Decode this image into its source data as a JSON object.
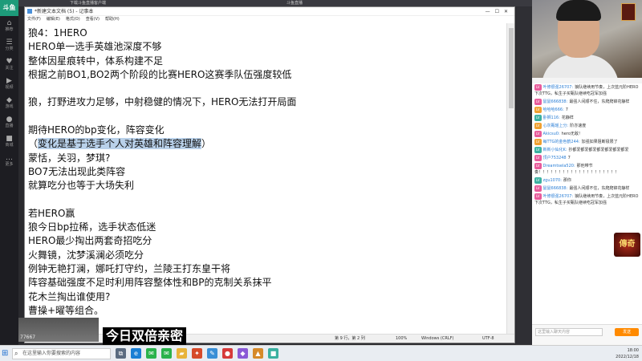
{
  "sidebar": {
    "logo": "斗鱼",
    "items": [
      {
        "icon": "home-icon",
        "glyph": "⌂",
        "label": "推荐"
      },
      {
        "icon": "category-icon",
        "glyph": "☰",
        "label": "分类"
      },
      {
        "icon": "follow-icon",
        "glyph": "♥",
        "label": "关注"
      },
      {
        "icon": "video-icon",
        "glyph": "▶",
        "label": "视频"
      },
      {
        "icon": "game-icon",
        "glyph": "◆",
        "label": "游戏"
      },
      {
        "icon": "live-icon",
        "glyph": "●",
        "label": "直播"
      },
      {
        "icon": "shop-icon",
        "glyph": "■",
        "label": "商城"
      },
      {
        "icon": "more-icon",
        "glyph": "…",
        "label": "更多"
      }
    ]
  },
  "browser_tabs": [
    "下载斗鱼直播客户端",
    "斗鱼直播"
  ],
  "notepad": {
    "title": "*新建文本文档 (5) - 记事本",
    "window_controls": "—☐✕",
    "menu": [
      "文件(F)",
      "编辑(E)",
      "格式(O)",
      "查看(V)",
      "帮助(H)"
    ],
    "lines": [
      {
        "text": "狼4：1HERO"
      },
      {
        "text": "HERO单一选手英雄池深度不够"
      },
      {
        "text": "整体因星痕转中，体系构建不足"
      },
      {
        "text": "根据之前BO1,BO2两个阶段的比赛HERO这赛季队伍强度较低"
      },
      {
        "text": ""
      },
      {
        "text": "狼，打野进攻力足够，中射稳健的情况下，HERO无法打开局面"
      },
      {
        "text": ""
      },
      {
        "text": "期待HERO的bp变化，阵容变化"
      },
      {
        "pre": "（",
        "sel": "变化是基于选手个人对英雄和阵容理解",
        "post": "）"
      },
      {
        "text": "蒙恬，关羽，梦琪?"
      },
      {
        "text": "BO7无法出现此类阵容"
      },
      {
        "text": "就算吃分也等于大场失利"
      },
      {
        "text": ""
      },
      {
        "text": "若HERO赢"
      },
      {
        "text": "狼今日bp拉稀，选手状态低迷"
      },
      {
        "text": "HERO最少掏出两套奇招吃分"
      },
      {
        "text": "火舞镜，沈梦溪澜必须吃分"
      },
      {
        "text": "例钟无艳打澜，娜吒打守约，兰陵王打东皇干将"
      },
      {
        "text": "阵容基础强度不足时利用阵容整体性和BP的克制关系抹平"
      },
      {
        "text": "花木兰掏出谁使用?"
      },
      {
        "text": "曹操+曜等组合。"
      }
    ],
    "status": {
      "position": "第 9 行，第 2 列",
      "zoom": "100%",
      "line_ending": "Windows (CRLF)",
      "encoding": "UTF-8"
    }
  },
  "caption": "今日双倍亲密",
  "viewer_count": "77667",
  "taskbar": {
    "search_placeholder": "在这里输入你要搜索的内容",
    "apps": [
      {
        "name": "task-view-icon",
        "glyph": "⧉",
        "color": "#5a6b80"
      },
      {
        "name": "edge-icon",
        "glyph": "e",
        "color": "#1a7fd4"
      },
      {
        "name": "wechat-icon",
        "glyph": "✉",
        "color": "#2bb24c"
      },
      {
        "name": "wechat2-icon",
        "glyph": "✉",
        "color": "#2bb24c"
      },
      {
        "name": "folder-icon",
        "glyph": "▰",
        "color": "#e8b33a"
      },
      {
        "name": "game-icon",
        "glyph": "✦",
        "color": "#d64a2a"
      },
      {
        "name": "notepad-icon",
        "glyph": "✎",
        "color": "#3a8fd6"
      },
      {
        "name": "app-icon",
        "glyph": "●",
        "color": "#d63a3a"
      },
      {
        "name": "app2-icon",
        "glyph": "◆",
        "color": "#8a5ad6"
      },
      {
        "name": "app3-icon",
        "glyph": "▲",
        "color": "#d68a2a"
      },
      {
        "name": "app4-icon",
        "glyph": "■",
        "color": "#3ab0a0"
      }
    ],
    "time": "18:00",
    "date": "2022/12/18"
  },
  "chat": {
    "top_label": "",
    "messages": [
      {
        "badge": "LV",
        "badge_color": "#e85a9a",
        "user": "叶修很强26707:",
        "text": "狼队继续用节奏，上次蓝元阶HERO下次TTG，私生子买甄队继续吃冠军加强"
      },
      {
        "badge": "LV",
        "badge_color": "#e85a9a",
        "user": "鼠鼠666838:",
        "text": "最强人间顺不住，东爬爬锦花静样"
      },
      {
        "badge": "LV",
        "badge_color": "#f0a030",
        "user": "哈哈哈666:",
        "text": "7"
      },
      {
        "badge": "LV",
        "badge_color": "#3ab0a0",
        "user": "卧狮116:",
        "text": "花静样"
      },
      {
        "badge": "LV",
        "badge_color": "#f0a030",
        "user": "心灰甄瑶上分:",
        "text": "阶亦速度"
      },
      {
        "badge": "LV",
        "badge_color": "#e85a9a",
        "user": "Akicsu0:",
        "text": "hero无敌！"
      },
      {
        "badge": "LV",
        "badge_color": "#f0a030",
        "user": "每TTG的金色鹤244:",
        "text": "加强如果阻断极限了"
      },
      {
        "badge": "LV",
        "badge_color": "#3ab0a0",
        "user": "新新小仙化K:",
        "text": "抄都爱都爱都爱都爱都爱都爱都爱"
      },
      {
        "badge": "LV",
        "badge_color": "#e85a9a",
        "user": "顶户753248",
        "text": "7"
      },
      {
        "badge": "LV",
        "badge_color": "#e85a9a",
        "user": "Dreamtsela520:",
        "text": "那他带节奏！！！！！！！！！！！！！！！！！！！！"
      },
      {
        "badge": "LV",
        "badge_color": "#3ab0a0",
        "user": "zgu1070:",
        "text": "那你"
      },
      {
        "badge": "LV",
        "badge_color": "#e85a9a",
        "user": "鼠鼠666838:",
        "text": "最强人间顺不住，东爬爬锦花静样"
      },
      {
        "badge": "LV",
        "badge_color": "#e85a9a",
        "user": "叶修很强26707:",
        "text": "狼队继续用节奏，上次蓝元阶HERO下次TTG，私生子买甄队继续吃冠军加强"
      }
    ],
    "input_placeholder": "这里输入聊天内容",
    "send_label": "发送",
    "promo": "傳奇"
  }
}
